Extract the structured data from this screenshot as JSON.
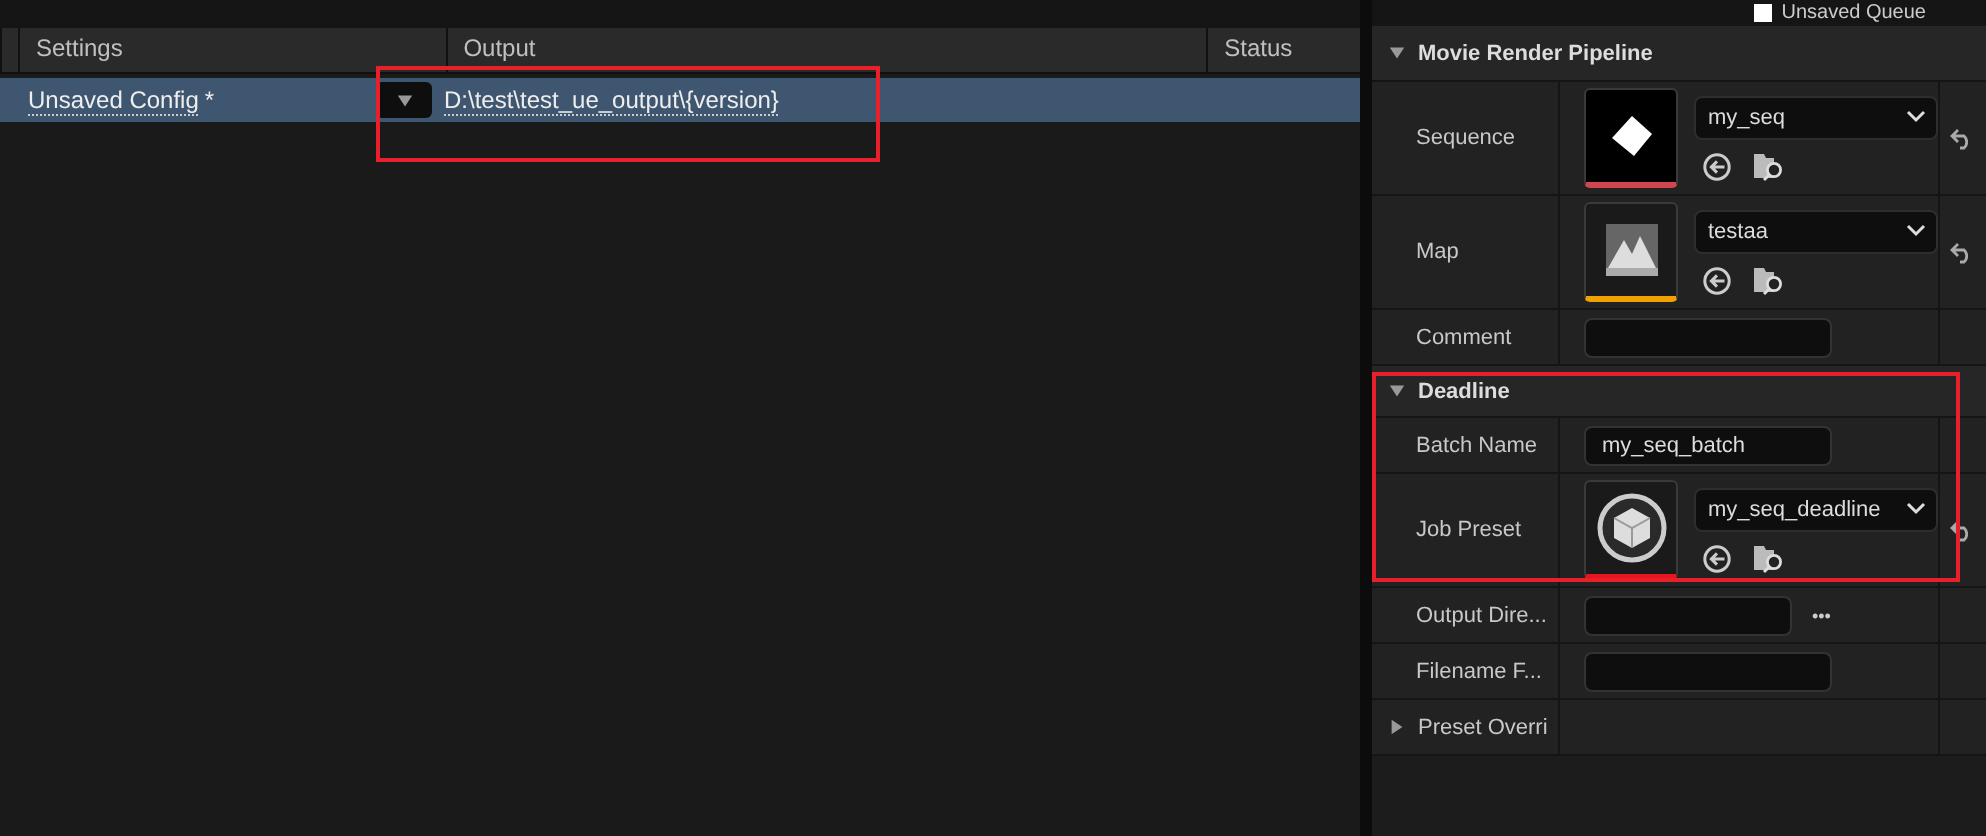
{
  "queue_toggle": {
    "label": "Unsaved Queue"
  },
  "jobs_table": {
    "columns": [
      "Settings",
      "Output",
      "Status"
    ],
    "rows": [
      {
        "settings": "Unsaved Config",
        "modified_mark": "*",
        "output": "D:\\test\\test_ue_output\\{version}",
        "selected": true
      }
    ]
  },
  "details": {
    "sections": [
      {
        "title": "Movie Render Pipeline",
        "expanded": true,
        "rows": [
          {
            "kind": "asset",
            "label": "Sequence",
            "value": "my_seq",
            "thumbnail": {
              "kind": "sequence",
              "color": "#d0464f"
            },
            "resettable": true
          },
          {
            "kind": "asset",
            "label": "Map",
            "value": "testaa",
            "thumbnail": {
              "kind": "map",
              "color": "#f0a000"
            },
            "resettable": true
          },
          {
            "kind": "text",
            "label": "Comment",
            "value": "",
            "resettable": false
          }
        ]
      },
      {
        "title": "Deadline",
        "expanded": true,
        "rows": [
          {
            "kind": "text",
            "label": "Batch Name",
            "value": "my_seq_batch",
            "resettable": false
          },
          {
            "kind": "asset",
            "label": "Job Preset",
            "value": "my_seq_deadline",
            "thumbnail": {
              "kind": "preset",
              "color": "#e8141e"
            },
            "resettable": true
          },
          {
            "kind": "path",
            "label": "Output Dire...",
            "value": "",
            "action": "•••",
            "resettable": false
          },
          {
            "kind": "text",
            "label": "Filename F...",
            "value": "",
            "resettable": false
          },
          {
            "kind": "group",
            "label": "Preset Overri",
            "expanded": false
          }
        ]
      }
    ]
  }
}
